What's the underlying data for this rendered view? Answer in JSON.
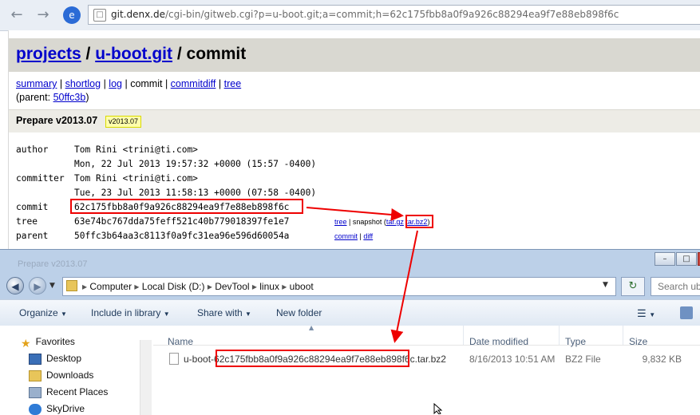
{
  "browser": {
    "back_icon": "back-arrow-icon",
    "forward_icon": "forward-arrow-icon",
    "url_host": "git.denx.de",
    "url_path": "/cgi-bin/gitweb.cgi?p=u-boot.git;a=commit;h=62c175fbb8a0f9a926c88294ea9f7e88eb898f6c"
  },
  "gitweb": {
    "breadcrumb": {
      "projects": "projects",
      "sep1": " / ",
      "repo": "u-boot.git",
      "sep2": " / ",
      "current": "commit"
    },
    "nav": {
      "summary": "summary",
      "shortlog": "shortlog",
      "log": "log",
      "commit": "commit",
      "commitdiff": "commitdiff",
      "tree": "tree"
    },
    "parent_prefix": "(parent: ",
    "parent_link": "50ffc3b",
    "parent_suffix": ")",
    "subject": "Prepare v2013.07",
    "tag": "v2013.07",
    "meta": {
      "author_label": "author",
      "author": "Tom Rini <trini@ti.com>",
      "author_date": "Mon, 22 Jul 2013 19:57:32 +0000 (15:57 -0400)",
      "committer_label": "committer",
      "committer": "Tom Rini <trini@ti.com>",
      "committer_date": "Tue, 23 Jul 2013 11:58:13 +0000 (07:58 -0400)",
      "commit_label": "commit",
      "commit_hash": "62c175fbb8a0f9a926c88294ea9f7e88eb898f6c",
      "tree_label": "tree",
      "tree_hash": "63e74bc767dda75feff521c40b779018397fe1e7",
      "parent_label": "parent",
      "parent_hash": "50ffc3b64aa3c8113f0a9fc31ea96e596d60054a"
    },
    "tree_links": {
      "tree": "tree",
      "snapshot": "snapshot (",
      "targz": "tar.gz",
      "tarbz2": "tar.bz2",
      "close": ")"
    },
    "parent_links": {
      "commit": "commit",
      "diff": "diff"
    }
  },
  "explorer": {
    "ghost_title": "Prepare v2013.07",
    "path": [
      "Computer",
      "Local Disk (D:)",
      "DevTool",
      "linux",
      "uboot"
    ],
    "search_placeholder": "Search ub",
    "toolbar": {
      "organize": "Organize",
      "include": "Include in library",
      "share": "Share with",
      "new_folder": "New folder"
    },
    "nav_items": [
      {
        "label": "Favorites",
        "icon": "star-icon"
      },
      {
        "label": "Desktop",
        "icon": "desktop-icon"
      },
      {
        "label": "Downloads",
        "icon": "downloads-folder-icon"
      },
      {
        "label": "Recent Places",
        "icon": "recent-places-icon"
      },
      {
        "label": "SkyDrive",
        "icon": "skydrive-icon"
      }
    ],
    "columns": {
      "name": "Name",
      "date": "Date modified",
      "type": "Type",
      "size": "Size"
    },
    "files": [
      {
        "name_prefix": "u-boot-",
        "name_hash": "62c175fbb8a0f9a926c88294ea9f7e88eb898f6c",
        "name_suffix": ".tar.bz2",
        "date": "8/16/2013 10:51 AM",
        "type": "BZ2 File",
        "size": "9,832 KB"
      }
    ]
  },
  "colors": {
    "annotation": "#ee0000",
    "link": "#0000cc",
    "gitweb_header": "#d9d8d1",
    "tag_bg": "#ffffaa"
  }
}
